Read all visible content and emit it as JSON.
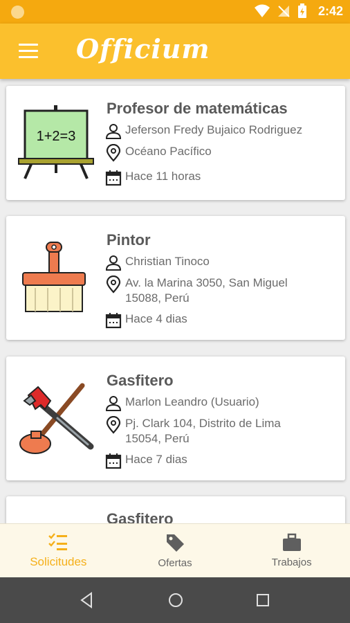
{
  "status_bar": {
    "time": "2:42"
  },
  "app_bar": {
    "title": "Officium"
  },
  "cards": [
    {
      "title": "Profesor de matemáticas",
      "person": "Jeferson Fredy Bujaico Rodriguez",
      "location_line1": "Océano Pacífico",
      "location_line2": "",
      "time": "Hace 11 horas",
      "board_text": "1+2=3"
    },
    {
      "title": "Pintor",
      "person": "Christian Tinoco",
      "location_line1": "Av. la Marina 3050, San Miguel",
      "location_line2": "15088, Perú",
      "time": "Hace 4 dias"
    },
    {
      "title": "Gasfitero",
      "person": "Marlon Leandro (Usuario)",
      "location_line1": "Pj. Clark 104, Distrito de Lima",
      "location_line2": "15054, Perú",
      "time": "Hace 7 dias"
    },
    {
      "title": "Gasfitero"
    }
  ],
  "bottom_nav": [
    {
      "label": "Solicitudes",
      "icon": "checklist-icon",
      "active": true
    },
    {
      "label": "Ofertas",
      "icon": "tag-icon",
      "active": false
    },
    {
      "label": "Trabajos",
      "icon": "briefcase-icon",
      "active": false
    }
  ],
  "colors": {
    "status_bar": "#f5a90f",
    "app_bar": "#fbc02d",
    "active_nav": "#f5b01a",
    "bottom_nav_bg": "#fdf8e8",
    "system_nav": "#4a4a4a"
  }
}
